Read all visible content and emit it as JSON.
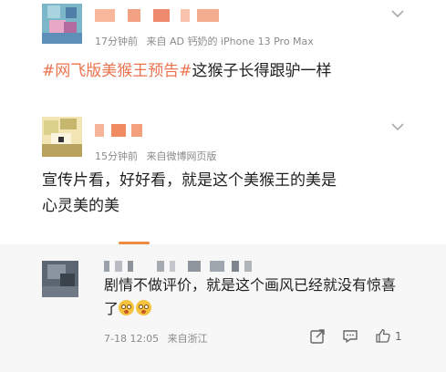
{
  "posts": [
    {
      "meta_time": "17分钟前",
      "meta_source": "来自 AD 钙奶的 iPhone 13 Pro Max",
      "text_hashtag": "#网飞版美猴王预告#",
      "text_rest": "这猴子长得跟驴一样",
      "avatar_icon": "pixelated-avatar",
      "menu_icon": "chevron-down-icon"
    },
    {
      "meta_time": "15分钟前",
      "meta_source": "来自微博网页版",
      "text_line1": "宣传片看，好好看，就是这个美猴王的美是",
      "text_line2": "心灵美的美",
      "avatar_icon": "pixelated-avatar",
      "menu_icon": "chevron-down-icon"
    },
    {
      "text_line1": "剧情不做评价，就是这个画风已经就没有惊喜",
      "text_line2": "了",
      "emoji_icon": "flushed-face-icon",
      "date": "7-18 12:05",
      "location": "来自浙江",
      "like_count": "1",
      "share_icon": "share-icon",
      "comment_icon": "comment-icon",
      "like_icon": "thumbs-up-icon"
    }
  ],
  "colors": {
    "hashtag": "#eb7350",
    "accent": "#f08a3e",
    "meta": "#8a8a8a"
  }
}
